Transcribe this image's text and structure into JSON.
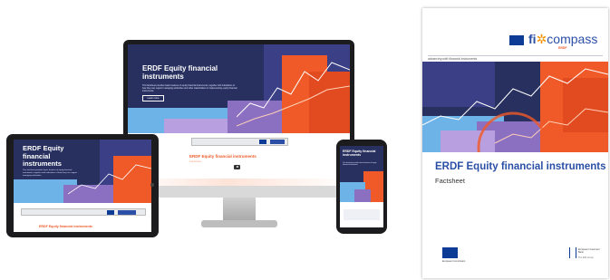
{
  "monitor": {
    "hero_title": "ERDF Equity financial instruments",
    "hero_text": "This factsheet provides basic features of equity financial instruments, together with indications of how they can support managing authorities and other stakeholders in implementing equity financial instruments.",
    "hero_button": "Learn more",
    "section_title": "ERDF Equity financial instruments",
    "section_sub": "Factsheet"
  },
  "tablet": {
    "hero_title": "ERDF Equity financial instruments",
    "hero_text": "This factsheet provides basic features of equity financial instruments, together with indications of how they can support managing authorities.",
    "section_title": "ERDF Equity financial instruments"
  },
  "phone": {
    "hero_title": "ERDF Equity financial instruments",
    "hero_text": "This factsheet provides basic features of equity financial instruments."
  },
  "cover": {
    "logo_fi": "fi",
    "logo_compass": "compass",
    "logo_erdf": "ERDF",
    "tagline": "advancing with financial instruments",
    "title": "ERDF Equity financial instruments",
    "subtitle": "Factsheet",
    "ec_label": "European Commission",
    "eib_label": "European Investment Bank",
    "eib_group": "The EIB Group"
  },
  "colors": {
    "navy": "#27305e",
    "orange": "#f05a28",
    "blue": "#2b4fa6",
    "purple": "#8b6fc1",
    "light_blue": "#6db3e8"
  },
  "icons": [
    "eu-flag-icon",
    "fi-compass-logo-icon",
    "eib-logo-icon",
    "play-icon"
  ]
}
